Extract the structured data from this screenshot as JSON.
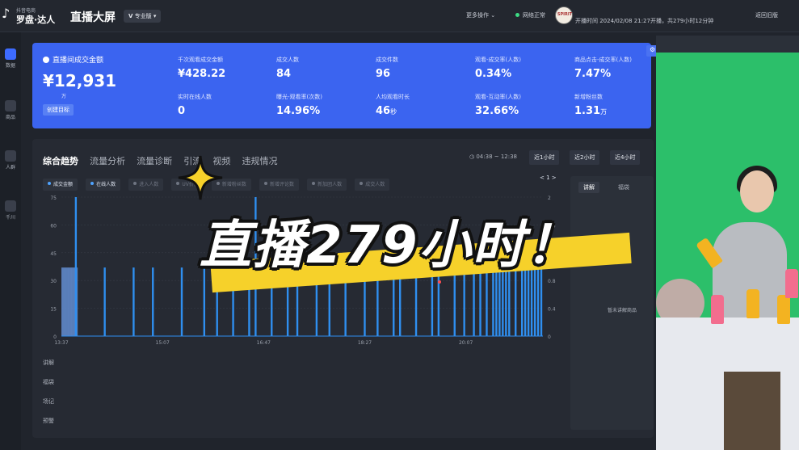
{
  "topbar": {
    "logo_small": "抖音电商",
    "logo_main": "罗盘·达人",
    "app_title": "直播大屏",
    "edition": "专业版",
    "edition_prefix": "V",
    "more_ops": "更多操作",
    "more_ops_chevron": "⌄",
    "net_status": "网络正常",
    "avatar_text": "SPIRIT",
    "live_info": "开播时间 2024/02/08 21:27开播，共279小时12分钟",
    "back": "返回旧版"
  },
  "leftnav": [
    {
      "label": "数据",
      "active": true
    },
    {
      "label": "商品",
      "active": false
    },
    {
      "label": "人群",
      "active": false
    },
    {
      "label": "千川",
      "active": false
    }
  ],
  "kpi": {
    "main_label": "直播间成交金额",
    "main_value": "¥12,931",
    "main_unit": "万",
    "goal_button": "创建目标",
    "metrics": [
      {
        "label": "千次观看成交金额",
        "value": "¥428.22",
        "unit": ""
      },
      {
        "label": "成交人数",
        "value": "84",
        "unit": ""
      },
      {
        "label": "成交件数",
        "value": "96",
        "unit": ""
      },
      {
        "label": "观看-成交率(人数)",
        "value": "0.34%",
        "unit": ""
      },
      {
        "label": "商品点击-成交率(人数)",
        "value": "7.47%",
        "unit": ""
      },
      {
        "label": "实时在线人数",
        "value": "0",
        "unit": ""
      },
      {
        "label": "曝光-观看率(次数)",
        "value": "14.96%",
        "unit": ""
      },
      {
        "label": "人均观看时长",
        "value": "46",
        "unit": "秒"
      },
      {
        "label": "观看-互动率(人数)",
        "value": "32.66%",
        "unit": ""
      },
      {
        "label": "新增粉丝数",
        "value": "1.31",
        "unit": "万"
      }
    ]
  },
  "trend": {
    "tabs": [
      "综合趋势",
      "流量分析",
      "流量诊断",
      "引流",
      "视频",
      "违规情况"
    ],
    "timerange": "04:38 ~ 12:38",
    "range_buttons": [
      "近1小时",
      "近2小时",
      "近4小时"
    ],
    "legend": [
      {
        "label": "成交金额",
        "on": true
      },
      {
        "label": "在线人数",
        "on": true
      },
      {
        "label": "进入人数",
        "on": false
      },
      {
        "label": "UV价值",
        "on": false
      },
      {
        "label": "新增粉丝数",
        "on": false
      },
      {
        "label": "新增评论数",
        "on": false
      },
      {
        "label": "新加团人数",
        "on": false
      },
      {
        "label": "成交人数",
        "on": false
      }
    ],
    "pager": "< 1 >",
    "side_labels": [
      "讲解",
      "福袋",
      "场记",
      "预警"
    ]
  },
  "explain": {
    "tabs": [
      "讲解",
      "福袋"
    ],
    "empty": "暂未讲解商品"
  },
  "caption": "直播279小时！",
  "colors": {
    "kpi_blue": "#3b64f0",
    "bar_blue": "#2f8ff0",
    "caption_yellow": "#f6d12a"
  },
  "chart_data": {
    "type": "bar",
    "x_ticks": [
      "13:37",
      "15:07",
      "16:47",
      "18:27",
      "20:07"
    ],
    "ylim_left": [
      0,
      75
    ],
    "y_ticks_left": [
      "75",
      "60",
      "45",
      "30",
      "15",
      "0"
    ],
    "ylim_right": [
      0,
      2
    ],
    "y_ticks_right": [
      "2",
      "1.6",
      "1.2",
      "0.8",
      "0.4",
      "0"
    ],
    "series": [
      {
        "name": "成交金额",
        "values": [
          37,
          37,
          37,
          37,
          37,
          0,
          0,
          0,
          0,
          0,
          0,
          0,
          0,
          0,
          0,
          0,
          0,
          0,
          0,
          0,
          0,
          0,
          0,
          0,
          0,
          0,
          0,
          0,
          0,
          0,
          0,
          0,
          0,
          0,
          0,
          0,
          0,
          0,
          0,
          0,
          0,
          0,
          0,
          0,
          0,
          0,
          0,
          0,
          0,
          0,
          0,
          0,
          0,
          0,
          0,
          0,
          0,
          0,
          0,
          0,
          0,
          0,
          0,
          0,
          0,
          0,
          0,
          0,
          0,
          0,
          0,
          0,
          0,
          0,
          0,
          0,
          0,
          0,
          0,
          0,
          0,
          0,
          0,
          0,
          0,
          0,
          0,
          0,
          0,
          0,
          0,
          0,
          0,
          0,
          0,
          0,
          0,
          0,
          0,
          0,
          0,
          0,
          0,
          0,
          0,
          0,
          0,
          0,
          0,
          0,
          0,
          0,
          0,
          0,
          0,
          0,
          0,
          0,
          0,
          0,
          0,
          0,
          0,
          0,
          0,
          0,
          0,
          0,
          0,
          0
        ]
      },
      {
        "name": "在线人数",
        "values": [
          0,
          0,
          0,
          0,
          75,
          0,
          0,
          0,
          0,
          0,
          0,
          0,
          0,
          37,
          0,
          0,
          0,
          0,
          0,
          0,
          0,
          0,
          37,
          0,
          0,
          0,
          0,
          0,
          37,
          0,
          0,
          0,
          0,
          0,
          0,
          0,
          0,
          37,
          0,
          0,
          0,
          0,
          0,
          0,
          37,
          0,
          0,
          0,
          37,
          0,
          0,
          0,
          0,
          37,
          0,
          0,
          0,
          0,
          37,
          0,
          75,
          0,
          0,
          0,
          0,
          37,
          0,
          0,
          0,
          0,
          37,
          0,
          0,
          37,
          0,
          0,
          0,
          0,
          0,
          37,
          0,
          0,
          0,
          37,
          0,
          0,
          0,
          0,
          37,
          0,
          0,
          0,
          0,
          0,
          37,
          0,
          0,
          0,
          37,
          0,
          0,
          0,
          0,
          37,
          0,
          37,
          0,
          0,
          0,
          0,
          37,
          0,
          0,
          0,
          0,
          37,
          0,
          37,
          0,
          0,
          0,
          0,
          37,
          0,
          0,
          37,
          0,
          0,
          37,
          0,
          37,
          0,
          37,
          0,
          37,
          37,
          37,
          37,
          37,
          37,
          0,
          37,
          0,
          37,
          37,
          37,
          37,
          37,
          37,
          37
        ]
      }
    ]
  }
}
